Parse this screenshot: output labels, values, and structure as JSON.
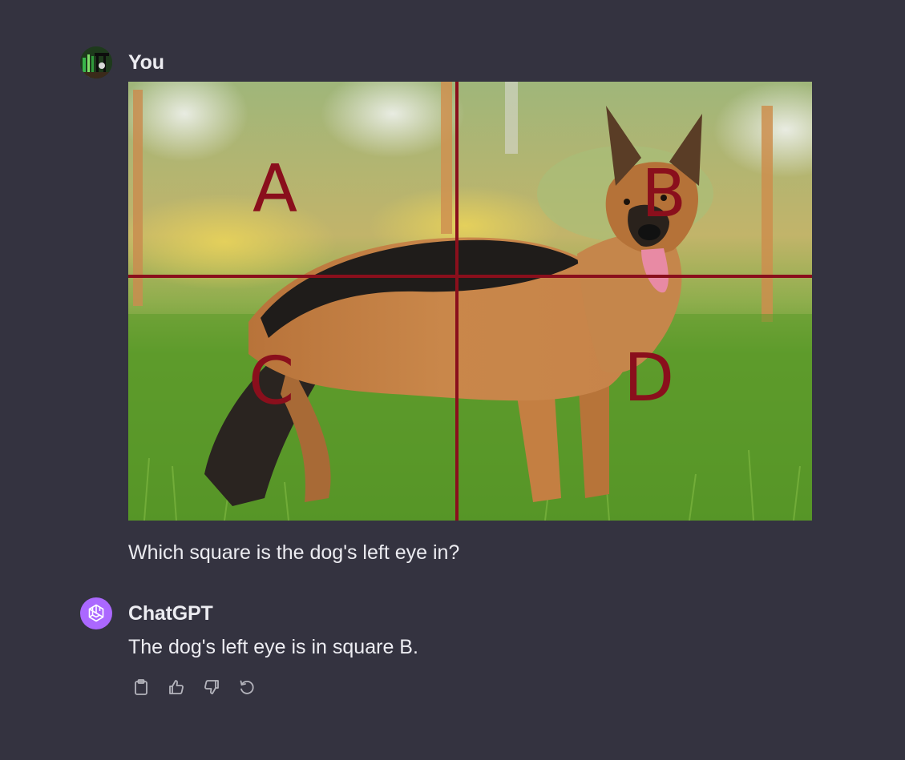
{
  "conversation": {
    "user": {
      "author": "You",
      "avatar_icon": "user-avatar",
      "image": {
        "icon": "photo-of-dog-with-grid",
        "quadrant_labels": [
          "A",
          "B",
          "C",
          "D"
        ],
        "grid_color": "#8a0f1c"
      },
      "text": "Which square is the dog's left eye in?"
    },
    "assistant": {
      "author": "ChatGPT",
      "avatar_icon": "chatgpt-logo-icon",
      "avatar_color": "#ab68ff",
      "text": "The dog's left eye is in square B."
    },
    "actions": [
      {
        "name": "copy",
        "icon": "clipboard-icon"
      },
      {
        "name": "good-response",
        "icon": "thumbs-up-icon"
      },
      {
        "name": "bad-response",
        "icon": "thumbs-down-icon"
      },
      {
        "name": "regenerate",
        "icon": "regenerate-icon"
      }
    ]
  },
  "theme": {
    "background": "#343340",
    "text": "#ececf1",
    "icon": "#b4b4bc"
  }
}
